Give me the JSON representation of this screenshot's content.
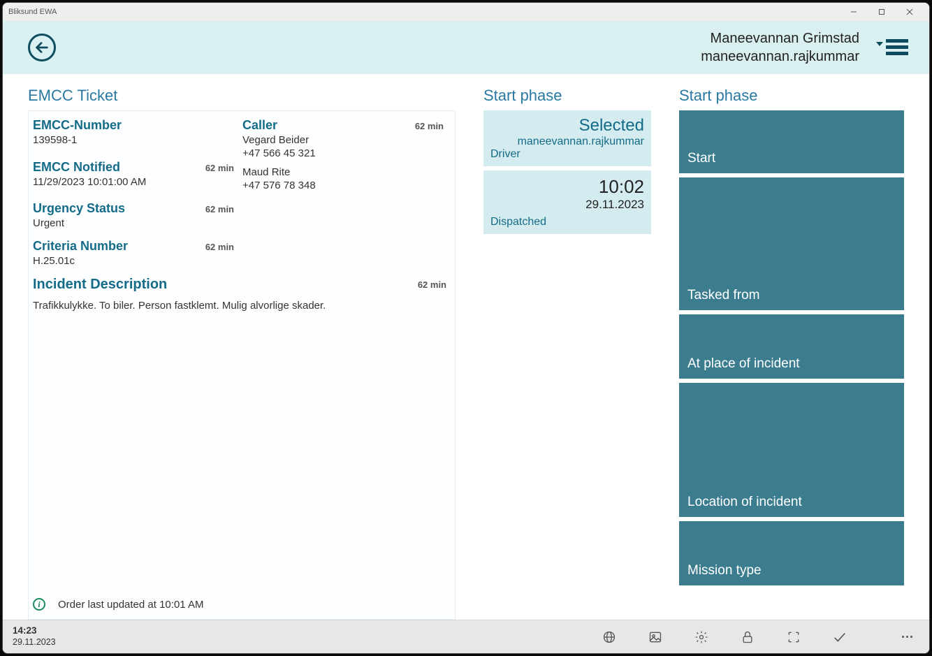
{
  "window": {
    "title": "Bliksund EWA"
  },
  "header": {
    "user_name": "Maneevannan Grimstad",
    "user_login": "maneevannan.rajkummar"
  },
  "ticket": {
    "title": "EMCC Ticket",
    "emcc_number_label": "EMCC-Number",
    "emcc_number": "139598-1",
    "caller_label": "Caller",
    "caller_age": "62 min",
    "caller1_name": "Vegard Beider",
    "caller1_phone": "+47 566 45 321",
    "caller2_name": "Maud Rite",
    "caller2_phone": "+47 576 78 348",
    "notified_label": "EMCC Notified",
    "notified_age": "62 min",
    "notified_value": "11/29/2023 10:01:00 AM",
    "urgency_label": "Urgency Status",
    "urgency_age": "62 min",
    "urgency_value": "Urgent",
    "criteria_label": "Criteria Number",
    "criteria_age": "62 min",
    "criteria_value": "H.25.01c",
    "description_label": "Incident Description",
    "description_age": "62 min",
    "description_text": "Trafikkulykke. To biler. Person fastklemt. Mulig alvorlige skader.",
    "order_updated": "Order last updated at 10:01 AM"
  },
  "phase_left": {
    "title": "Start phase",
    "selected_label": "Selected",
    "selected_user": "maneevannan.rajkummar",
    "selected_role": "Driver",
    "dispatched_time": "10:02",
    "dispatched_date": "29.11.2023",
    "dispatched_label": "Dispatched"
  },
  "phase_right": {
    "title": "Start phase",
    "tiles": {
      "t1": "Start",
      "t2": "Tasked from",
      "t3": "At place of incident",
      "t4": "Location of incident",
      "t5": "Mission type"
    }
  },
  "bottombar": {
    "time": "14:23",
    "date": "29.11.2023"
  }
}
